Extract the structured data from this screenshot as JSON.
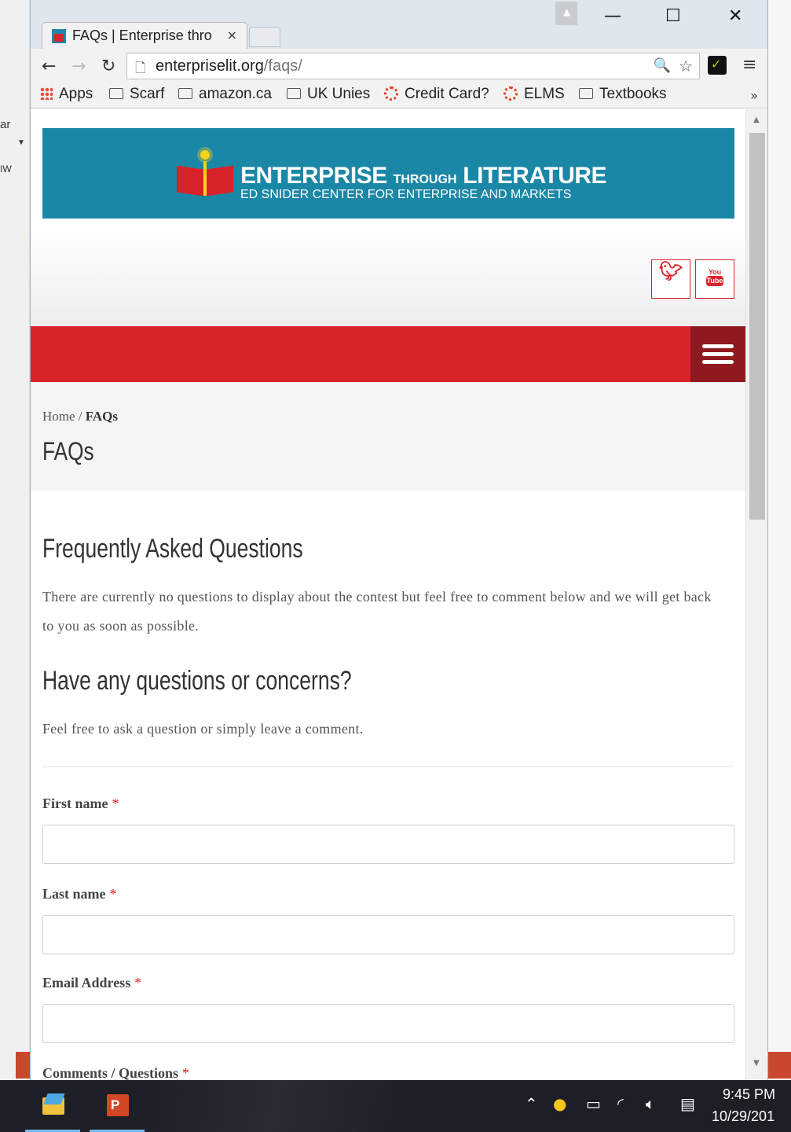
{
  "browser": {
    "tab_title": "FAQs | Enterprise thro",
    "tab_close": "×",
    "url_host": "enterpriselit.org",
    "url_path": "/faqs/",
    "window_minimize": "—",
    "window_maximize": "☐",
    "window_close": "✕",
    "bookmarks": [
      {
        "label": "Apps",
        "icon": "apps-grid-icon"
      },
      {
        "label": "Scarf",
        "icon": "folder-icon"
      },
      {
        "label": "amazon.ca",
        "icon": "folder-icon"
      },
      {
        "label": "UK Unies",
        "icon": "folder-icon"
      },
      {
        "label": "Credit Card?",
        "icon": "ring-icon"
      },
      {
        "label": "ELMS",
        "icon": "ring-icon"
      },
      {
        "label": "Textbooks",
        "icon": "folder-icon"
      }
    ],
    "bookmarks_more": "»"
  },
  "site": {
    "logo_title_main": "ENTERPRISE",
    "logo_title_through": "THROUGH",
    "logo_title_end": "LITERATURE",
    "logo_subtitle": "ED SNIDER CENTER FOR ENTERPRISE AND MARKETS",
    "colors": {
      "banner": "#1b87a6",
      "accent": "#d8232a",
      "menu_dark": "#8e1a1f"
    }
  },
  "social": {
    "twitter_icon": "twitter-icon",
    "youtube_you": "You",
    "youtube_tube": "Tube"
  },
  "breadcrumb": {
    "home": "Home",
    "separator": " / ",
    "current": "FAQs"
  },
  "page_title": "FAQs",
  "content": {
    "faq_heading": "Frequently Asked Questions",
    "faq_text": "There are currently no questions to display about the contest but feel free to comment below and we will get back to you as soon as possible.",
    "contact_heading": "Have any questions or concerns?",
    "contact_text": "Feel free to ask a question or simply leave a comment."
  },
  "form": {
    "required_mark": "*",
    "fields": [
      {
        "label": "First name",
        "value": ""
      },
      {
        "label": "Last name",
        "value": ""
      },
      {
        "label": "Email Address",
        "value": ""
      },
      {
        "label": "Comments / Questions"
      }
    ]
  },
  "taskbar": {
    "time": "9:45 PM",
    "date": "10/29/201"
  }
}
